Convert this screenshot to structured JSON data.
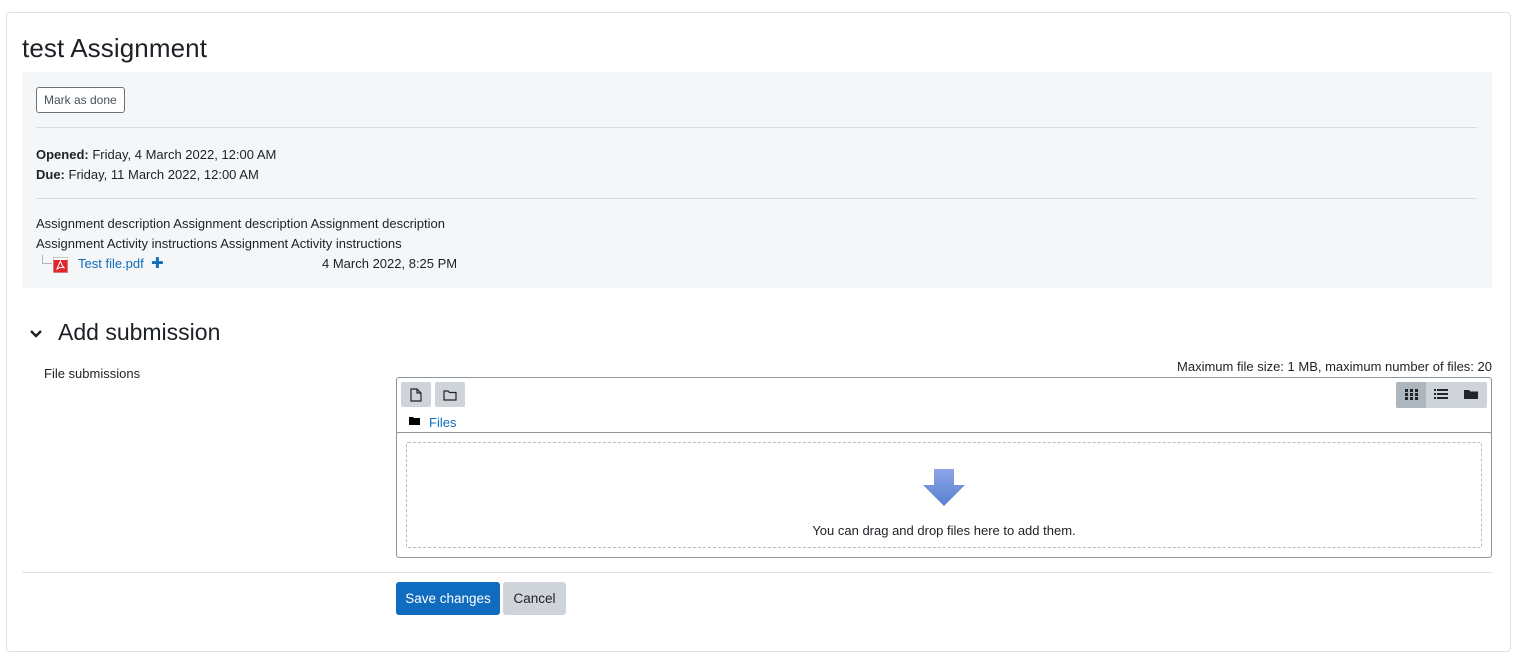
{
  "page": {
    "title": "test Assignment"
  },
  "activity": {
    "mark_done_label": "Mark as done",
    "opened_label": "Opened:",
    "opened_value": "Friday, 4 March 2022, 12:00 AM",
    "due_label": "Due:",
    "due_value": "Friday, 11 March 2022, 12:00 AM",
    "description": "Assignment description Assignment description Assignment description",
    "instructions": "Assignment Activity instructions Assignment Activity instructions",
    "attachment": {
      "name": "Test file.pdf",
      "date": "4 March 2022, 8:25 PM",
      "icon": "pdf-icon"
    }
  },
  "submission": {
    "section_title": "Add submission",
    "field_label": "File submissions",
    "limits_text": "Maximum file size: 1 MB, maximum number of files: 20",
    "filepicker": {
      "toolbar_icons": [
        "add-file-icon",
        "create-folder-icon"
      ],
      "view_icons": [
        "grid-view-icon",
        "list-view-icon",
        "tree-view-icon"
      ],
      "active_view": "grid-view-icon",
      "breadcrumb": "Files",
      "drop_text": "You can drag and drop files here to add them."
    }
  },
  "actions": {
    "save_label": "Save changes",
    "cancel_label": "Cancel"
  },
  "colors": {
    "primary": "#0f6cbf",
    "activity_bg": "#f5f6f7",
    "secondary_btn": "#ced4da",
    "drop_arrow": "#6b8fd8"
  }
}
